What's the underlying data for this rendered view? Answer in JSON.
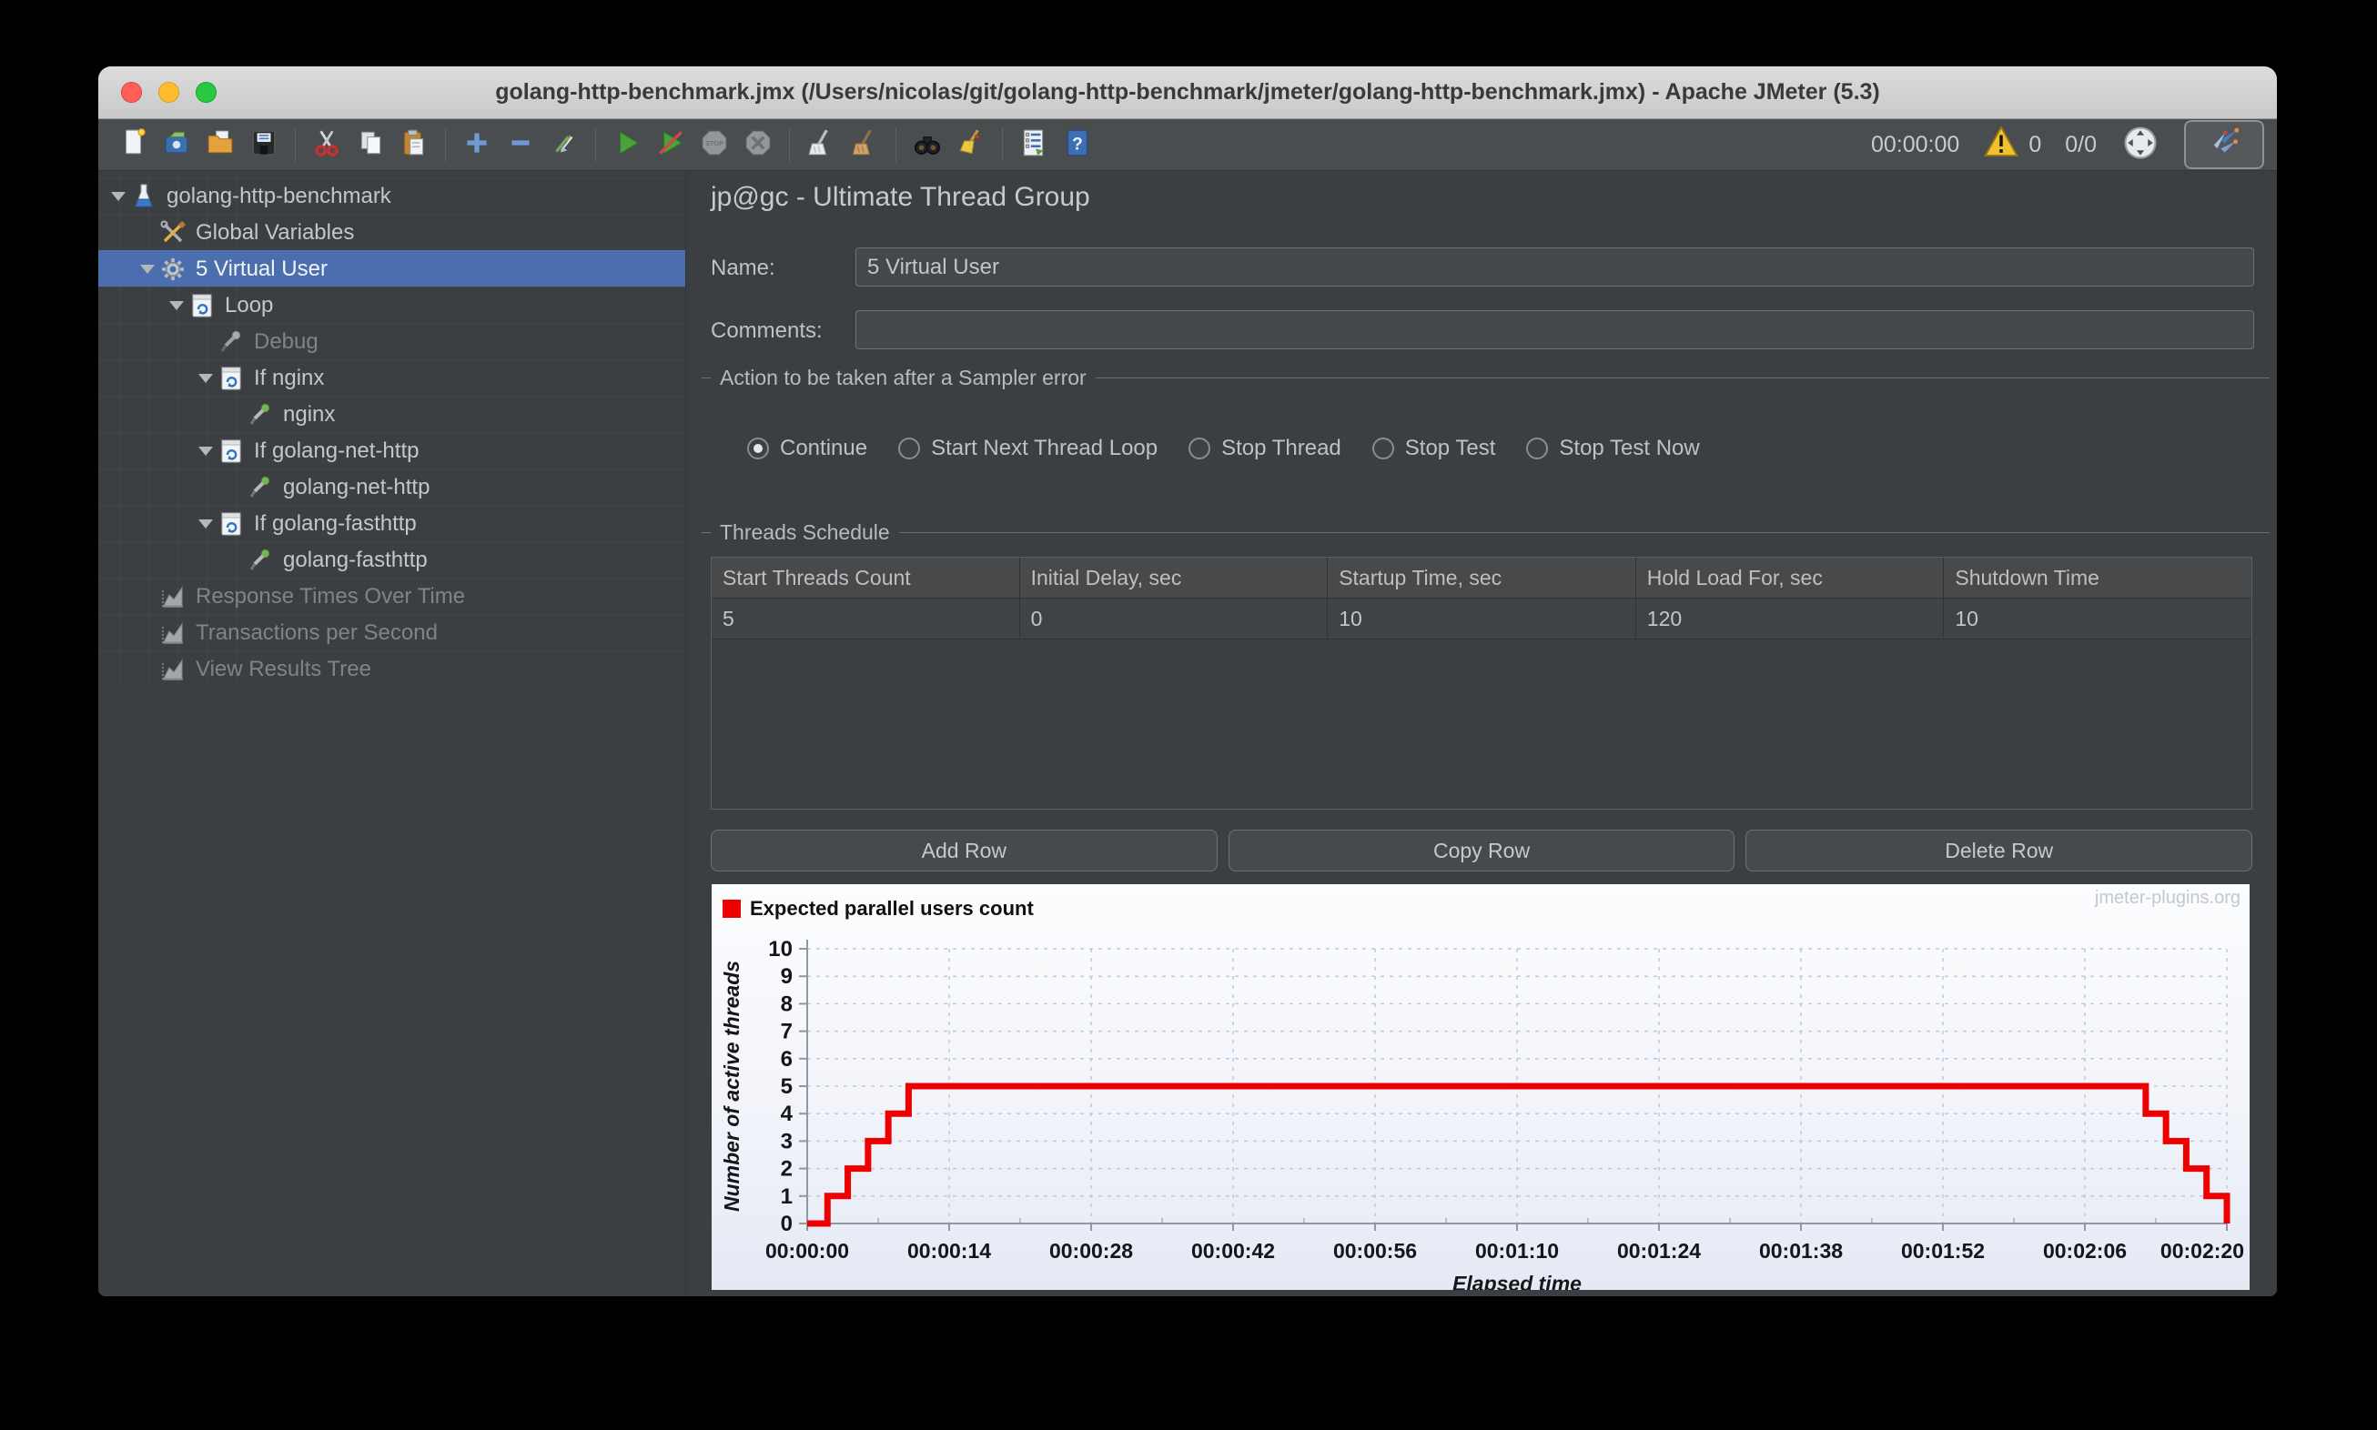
{
  "titlebar": {
    "title": "golang-http-benchmark.jmx (/Users/nicolas/git/golang-http-benchmark/jmeter/golang-http-benchmark.jmx) - Apache JMeter (5.3)"
  },
  "toolbar": {
    "groups": [
      [
        "new",
        "templates",
        "open",
        "save"
      ],
      [
        "cut",
        "copy",
        "paste"
      ],
      [
        "expand-all",
        "collapse-all",
        "toggle"
      ],
      [
        "start",
        "start-no-timers",
        "stop",
        "shutdown"
      ],
      [
        "clear",
        "clear-all"
      ],
      [
        "search",
        "search-reset"
      ],
      [
        "function-helper",
        "help"
      ]
    ],
    "timer": "00:00:00",
    "error_count": "0",
    "thread_ratio": "0/0"
  },
  "tree": {
    "items": [
      {
        "label": "golang-http-benchmark",
        "icon": "test-plan",
        "level": 0,
        "arrow": true
      },
      {
        "label": "Global Variables",
        "icon": "variables",
        "level": 1
      },
      {
        "label": "5 Virtual User",
        "icon": "thread-group",
        "level": 1,
        "arrow": true,
        "selected": true
      },
      {
        "label": "Loop",
        "icon": "loop-controller",
        "level": 2,
        "arrow": true
      },
      {
        "label": "Debug",
        "icon": "sampler-gray",
        "level": 3,
        "disabled": true
      },
      {
        "label": "If nginx",
        "icon": "if-controller",
        "level": 3,
        "arrow": true
      },
      {
        "label": "nginx",
        "icon": "sampler-green",
        "level": 4
      },
      {
        "label": "If golang-net-http",
        "icon": "if-controller",
        "level": 3,
        "arrow": true
      },
      {
        "label": "golang-net-http",
        "icon": "sampler-green",
        "level": 4
      },
      {
        "label": "If golang-fasthttp",
        "icon": "if-controller",
        "level": 3,
        "arrow": true
      },
      {
        "label": "golang-fasthttp",
        "icon": "sampler-green",
        "level": 4
      },
      {
        "label": "Response Times Over Time",
        "icon": "listener-chart",
        "level": 1,
        "disabled": true
      },
      {
        "label": "Transactions per Second",
        "icon": "listener-chart",
        "level": 1,
        "disabled": true
      },
      {
        "label": "View Results Tree",
        "icon": "listener-chart",
        "level": 1,
        "disabled": true
      }
    ]
  },
  "main": {
    "title": "jp@gc - Ultimate Thread Group",
    "name_label": "Name:",
    "name_value": "5 Virtual User",
    "comments_label": "Comments:",
    "comments_value": "",
    "action_group": {
      "title": "Action to be taken after a Sampler error",
      "options": [
        {
          "label": "Continue",
          "selected": true
        },
        {
          "label": "Start Next Thread Loop",
          "selected": false
        },
        {
          "label": "Stop Thread",
          "selected": false
        },
        {
          "label": "Stop Test",
          "selected": false
        },
        {
          "label": "Stop Test Now",
          "selected": false
        }
      ]
    },
    "schedule_group": {
      "title": "Threads Schedule",
      "columns": [
        "Start Threads Count",
        "Initial Delay, sec",
        "Startup Time, sec",
        "Hold Load For, sec",
        "Shutdown Time"
      ],
      "rows": [
        [
          "5",
          "0",
          "10",
          "120",
          "10"
        ]
      ],
      "buttons": [
        "Add Row",
        "Copy Row",
        "Delete Row"
      ]
    }
  },
  "colors": {
    "selection": "#4b6eaf",
    "chart_line": "#ee0000",
    "warning": "#f2c12e"
  },
  "chart_data": {
    "type": "line",
    "step": true,
    "legend": "Expected parallel users count",
    "watermark": "jmeter-plugins.org",
    "xlabel": "Elapsed time",
    "ylabel": "Number of active threads",
    "ylim": [
      0,
      10
    ],
    "yticks": [
      0,
      1,
      2,
      3,
      4,
      5,
      6,
      7,
      8,
      9,
      10
    ],
    "x_seconds": [
      0,
      14,
      28,
      42,
      56,
      70,
      84,
      98,
      112,
      126,
      140
    ],
    "xtick_labels": [
      "00:00:00",
      "00:00:14",
      "00:00:28",
      "00:00:42",
      "00:00:56",
      "00:01:10",
      "00:01:24",
      "00:01:38",
      "00:01:52",
      "00:02:06",
      "00:02:20"
    ],
    "grid": true,
    "legend_position": "top-left",
    "points": [
      [
        0,
        0
      ],
      [
        2,
        0
      ],
      [
        2,
        1
      ],
      [
        4,
        1
      ],
      [
        4,
        2
      ],
      [
        6,
        2
      ],
      [
        6,
        3
      ],
      [
        8,
        3
      ],
      [
        8,
        4
      ],
      [
        10,
        4
      ],
      [
        10,
        5
      ],
      [
        132,
        5
      ],
      [
        132,
        4
      ],
      [
        134,
        4
      ],
      [
        134,
        3
      ],
      [
        136,
        3
      ],
      [
        136,
        2
      ],
      [
        138,
        2
      ],
      [
        138,
        1
      ],
      [
        140,
        1
      ],
      [
        140,
        0
      ]
    ]
  }
}
